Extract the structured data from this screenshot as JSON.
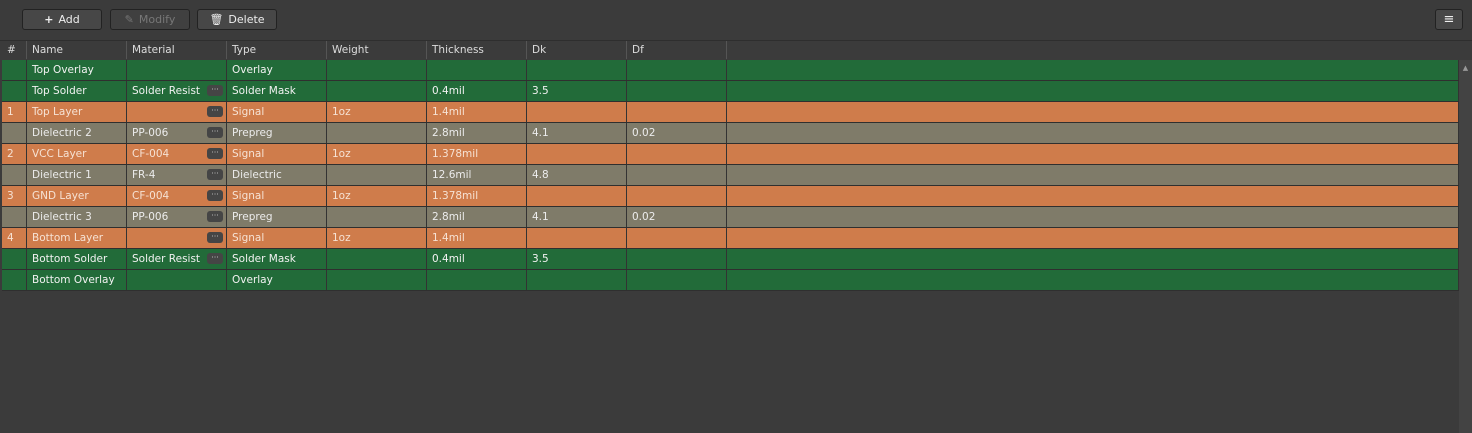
{
  "toolbar": {
    "add": "Add",
    "modify": "Modify",
    "delete": "Delete"
  },
  "columns": [
    "#",
    "Name",
    "Material",
    "Type",
    "Weight",
    "Thickness",
    "Dk",
    "Df"
  ],
  "rows": [
    {
      "num": "",
      "name": "Top Overlay",
      "material": "",
      "type": "Overlay",
      "weight": "",
      "thickness": "",
      "dk": "",
      "df": "",
      "kind": "Overlay",
      "more": false
    },
    {
      "num": "",
      "name": "Top Solder",
      "material": "Solder Resist",
      "type": "Solder Mask",
      "weight": "",
      "thickness": "0.4mil",
      "dk": "3.5",
      "df": "",
      "kind": "SolderMask",
      "more": true
    },
    {
      "num": "1",
      "name": "Top Layer",
      "material": "",
      "type": "Signal",
      "weight": "1oz",
      "thickness": "1.4mil",
      "dk": "",
      "df": "",
      "kind": "Signal",
      "more": true
    },
    {
      "num": "",
      "name": "Dielectric 2",
      "material": "PP-006",
      "type": "Prepreg",
      "weight": "",
      "thickness": "2.8mil",
      "dk": "4.1",
      "df": "0.02",
      "kind": "Dielectric",
      "more": true
    },
    {
      "num": "2",
      "name": "VCC Layer",
      "material": "CF-004",
      "type": "Signal",
      "weight": "1oz",
      "thickness": "1.378mil",
      "dk": "",
      "df": "",
      "kind": "Signal",
      "more": true
    },
    {
      "num": "",
      "name": "Dielectric 1",
      "material": "FR-4",
      "type": "Dielectric",
      "weight": "",
      "thickness": "12.6mil",
      "dk": "4.8",
      "df": "",
      "kind": "Dielectric",
      "more": true
    },
    {
      "num": "3",
      "name": "GND Layer",
      "material": "CF-004",
      "type": "Signal",
      "weight": "1oz",
      "thickness": "1.378mil",
      "dk": "",
      "df": "",
      "kind": "Signal",
      "more": true
    },
    {
      "num": "",
      "name": "Dielectric 3",
      "material": "PP-006",
      "type": "Prepreg",
      "weight": "",
      "thickness": "2.8mil",
      "dk": "4.1",
      "df": "0.02",
      "kind": "Dielectric",
      "more": true
    },
    {
      "num": "4",
      "name": "Bottom Layer",
      "material": "",
      "type": "Signal",
      "weight": "1oz",
      "thickness": "1.4mil",
      "dk": "",
      "df": "",
      "kind": "Signal",
      "more": true
    },
    {
      "num": "",
      "name": "Bottom Solder",
      "material": "Solder Resist",
      "type": "Solder Mask",
      "weight": "",
      "thickness": "0.4mil",
      "dk": "3.5",
      "df": "",
      "kind": "SolderMask",
      "more": true
    },
    {
      "num": "",
      "name": "Bottom Overlay",
      "material": "",
      "type": "Overlay",
      "weight": "",
      "thickness": "",
      "dk": "",
      "df": "",
      "kind": "Overlay",
      "more": false
    }
  ]
}
